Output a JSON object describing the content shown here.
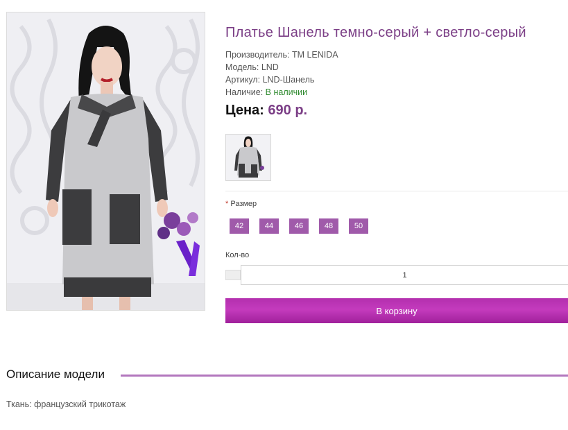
{
  "product": {
    "title": "Платье Шанель темно-серый + светло-серый",
    "manufacturer_label": "Производитель:",
    "manufacturer": "TM LENIDA",
    "model_label": "Модель:",
    "model": "LND",
    "sku_label": "Артикул:",
    "sku": "LND-Шанель",
    "availability_label": "Наличие:",
    "availability": "В наличии",
    "price_label": "Цена:",
    "price": "690 р."
  },
  "options": {
    "size_required_mark": "*",
    "size_label": "Размер",
    "sizes": [
      "42",
      "44",
      "46",
      "48",
      "50"
    ],
    "quantity_label": "Кол-во",
    "quantity_value": "1"
  },
  "actions": {
    "add_to_cart": "В корзину"
  },
  "description": {
    "heading": "Описание модели",
    "text": "Ткань: французский трикотаж"
  },
  "colors": {
    "accent": "#7b3e86",
    "size_button": "#a05aaa",
    "cart_button": "#b32fae",
    "in_stock": "#2f8a2f",
    "divider": "#b276bd"
  }
}
